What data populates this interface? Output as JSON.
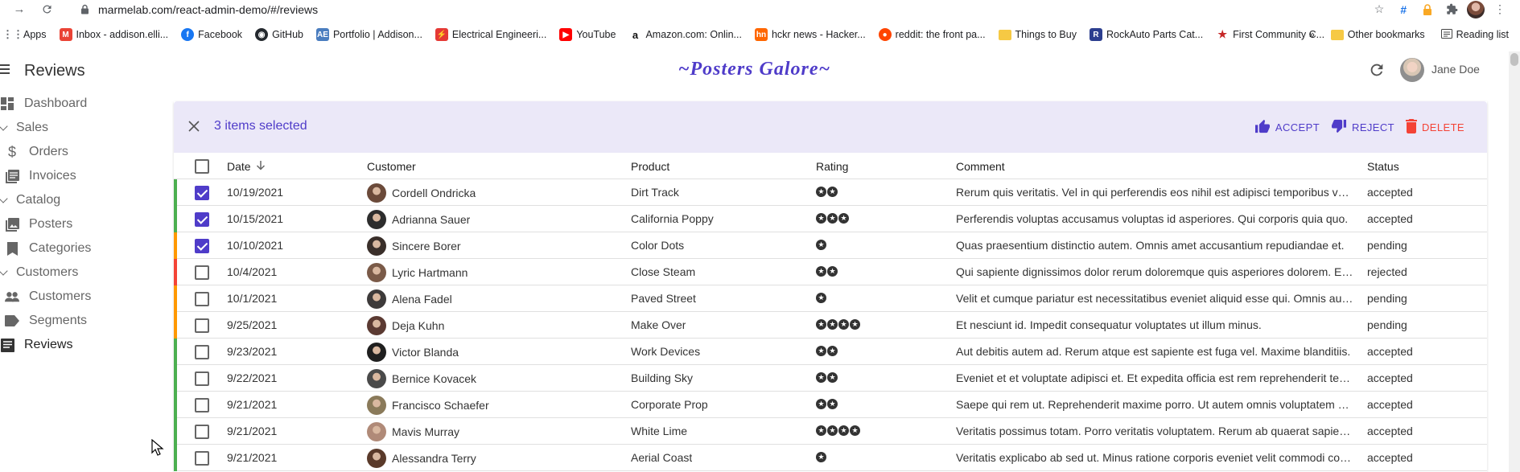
{
  "browser": {
    "url": "marmelab.com/react-admin-demo/#/reviews",
    "bookmarks": [
      {
        "label": "Apps",
        "icon": "apps-grid-icon",
        "color": "#5f6368"
      },
      {
        "label": "Inbox - addison.elli...",
        "icon": "gmail-icon",
        "color": "#ea4335"
      },
      {
        "label": "Facebook",
        "icon": "facebook-icon",
        "color": "#1877f2"
      },
      {
        "label": "GitHub",
        "icon": "github-icon",
        "color": "#24292e"
      },
      {
        "label": "Portfolio | Addison...",
        "icon": "portfolio-icon",
        "color": "#4a7dbf"
      },
      {
        "label": "Electrical Engineeri...",
        "icon": "electrical-icon",
        "color": "#e53935"
      },
      {
        "label": "YouTube",
        "icon": "youtube-icon",
        "color": "#ff0000"
      },
      {
        "label": "Amazon.com: Onlin...",
        "icon": "amazon-icon",
        "color": "#111111"
      },
      {
        "label": "hckr news - Hacker...",
        "icon": "hackernews-icon",
        "color": "#ff6600"
      },
      {
        "label": "reddit: the front pa...",
        "icon": "reddit-icon",
        "color": "#ff4500"
      },
      {
        "label": "Things to Buy",
        "icon": "folder-icon",
        "color": "#f6c944"
      },
      {
        "label": "RockAuto Parts Cat...",
        "icon": "rockauto-icon",
        "color": "#2c3e8f"
      },
      {
        "label": "First Community C...",
        "icon": "star-bookmark-icon",
        "color": "#c62828"
      }
    ],
    "overflow": "»",
    "other_bookmarks": "Other bookmarks",
    "reading_list": "Reading list"
  },
  "app": {
    "page_title": "Reviews",
    "brand": "~Posters Galore~",
    "user_name": "Jane Doe",
    "accent": "#4f3cc9"
  },
  "sidebar": {
    "items": [
      {
        "label": "Dashboard",
        "icon": "dashboard-icon",
        "kind": "link"
      },
      {
        "label": "Sales",
        "icon": "chevron-down-icon",
        "kind": "group"
      },
      {
        "label": "Orders",
        "icon": "dollar-icon",
        "kind": "link"
      },
      {
        "label": "Invoices",
        "icon": "invoice-icon",
        "kind": "link"
      },
      {
        "label": "Catalog",
        "icon": "chevron-down-icon",
        "kind": "group"
      },
      {
        "label": "Posters",
        "icon": "image-icon",
        "kind": "link"
      },
      {
        "label": "Categories",
        "icon": "bookmark-icon",
        "kind": "link"
      },
      {
        "label": "Customers",
        "icon": "chevron-down-icon",
        "kind": "group"
      },
      {
        "label": "Customers",
        "icon": "people-icon",
        "kind": "link"
      },
      {
        "label": "Segments",
        "icon": "label-icon",
        "kind": "link"
      },
      {
        "label": "Reviews",
        "icon": "comment-icon",
        "kind": "link",
        "active": true
      }
    ]
  },
  "bulk": {
    "selected_text": "3 items selected",
    "accept": "ACCEPT",
    "reject": "REJECT",
    "delete": "DELETE"
  },
  "table": {
    "columns": {
      "date": "Date",
      "customer": "Customer",
      "product": "Product",
      "rating": "Rating",
      "comment": "Comment",
      "status": "Status"
    },
    "status_colors": {
      "accepted": "#4caf50",
      "pending": "#ff9800",
      "rejected": "#f44336"
    },
    "rows": [
      {
        "checked": true,
        "date": "10/19/2021",
        "customer": "Cordell Ondricka",
        "avatar": "#6b4a3a",
        "product": "Dirt Track",
        "rating": 2,
        "comment": "Rerum quis veritatis. Vel in qui perferendis eos nihil est adipisci temporibus voluptas.",
        "status": "accepted"
      },
      {
        "checked": true,
        "date": "10/15/2021",
        "customer": "Adrianna Sauer",
        "avatar": "#2d2d2d",
        "product": "California Poppy",
        "rating": 3,
        "comment": "Perferendis voluptas accusamus voluptas id asperiores. Qui corporis quia quo.",
        "status": "accepted"
      },
      {
        "checked": true,
        "date": "10/10/2021",
        "customer": "Sincere Borer",
        "avatar": "#3a2f2a",
        "product": "Color Dots",
        "rating": 1,
        "comment": "Quas praesentium distinctio autem. Omnis amet accusantium repudiandae et.",
        "status": "pending"
      },
      {
        "checked": false,
        "date": "10/4/2021",
        "customer": "Lyric Hartmann",
        "avatar": "#7a5a48",
        "product": "Close Steam",
        "rating": 2,
        "comment": "Qui sapiente dignissimos dolor rerum doloremque quis asperiores dolorem. Et sed.",
        "status": "rejected"
      },
      {
        "checked": false,
        "date": "10/1/2021",
        "customer": "Alena Fadel",
        "avatar": "#3d3a3a",
        "product": "Paved Street",
        "rating": 1,
        "comment": "Velit et cumque pariatur est necessitatibus eveniet aliquid esse qui. Omnis autem.",
        "status": "pending"
      },
      {
        "checked": false,
        "date": "9/25/2021",
        "customer": "Deja Kuhn",
        "avatar": "#5b3a32",
        "product": "Make Over",
        "rating": 4,
        "comment": "Et nesciunt id. Impedit consequatur voluptates ut illum minus.",
        "status": "pending"
      },
      {
        "checked": false,
        "date": "9/23/2021",
        "customer": "Victor Blanda",
        "avatar": "#1f1f1f",
        "product": "Work Devices",
        "rating": 2,
        "comment": "Aut debitis autem ad. Rerum atque est sapiente est fuga vel. Maxime blanditiis.",
        "status": "accepted"
      },
      {
        "checked": false,
        "date": "9/22/2021",
        "customer": "Bernice Kovacek",
        "avatar": "#4a4a4a",
        "product": "Building Sky",
        "rating": 2,
        "comment": "Eveniet et et voluptate adipisci et. Et expedita officia est rem reprehenderit tempora.",
        "status": "accepted"
      },
      {
        "checked": false,
        "date": "9/21/2021",
        "customer": "Francisco Schaefer",
        "avatar": "#8a7a5a",
        "product": "Corporate Prop",
        "rating": 2,
        "comment": "Saepe qui rem ut. Reprehenderit maxime porro. Ut autem omnis voluptatem minima.",
        "status": "accepted"
      },
      {
        "checked": false,
        "date": "9/21/2021",
        "customer": "Mavis Murray",
        "avatar": "#b08a78",
        "product": "White Lime",
        "rating": 4,
        "comment": "Veritatis possimus totam. Porro veritatis voluptatem. Rerum ab quaerat sapiente.",
        "status": "accepted"
      },
      {
        "checked": false,
        "date": "9/21/2021",
        "customer": "Alessandra Terry",
        "avatar": "#5a3a2a",
        "product": "Aerial Coast",
        "rating": 1,
        "comment": "Veritatis explicabo ab sed ut. Minus ratione corporis eveniet velit commodi consequatur.",
        "status": "accepted"
      }
    ]
  }
}
